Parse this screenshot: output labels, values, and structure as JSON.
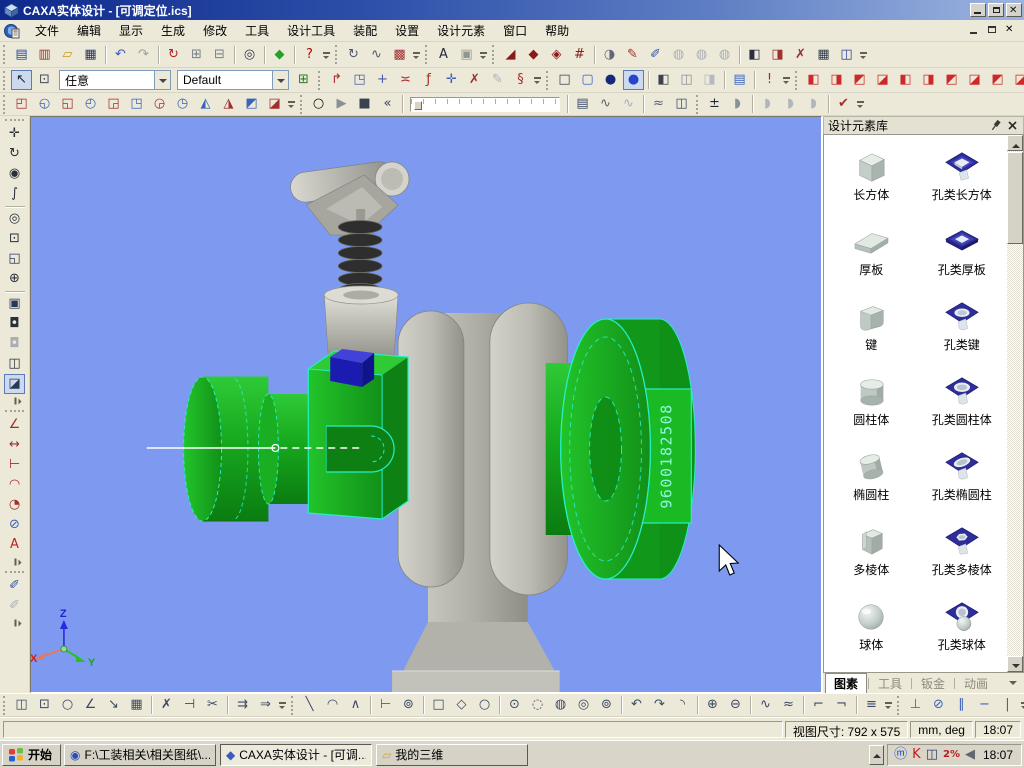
{
  "window": {
    "title": "CAXA实体设计 - [可调定位.ics]"
  },
  "menu": {
    "items": [
      "文件",
      "编辑",
      "显示",
      "生成",
      "修改",
      "工具",
      "设计工具",
      "装配",
      "设置",
      "设计元素",
      "窗口",
      "帮助"
    ]
  },
  "toolbars": {
    "row1": [
      {
        "t": "g"
      },
      {
        "n": "new-document",
        "g": "▤",
        "c": "#2a4a9a"
      },
      {
        "n": "new-from-template",
        "g": "▥",
        "c": "#a03030"
      },
      {
        "n": "open-file",
        "g": "▱",
        "c": "#c89a20"
      },
      {
        "n": "save-file",
        "g": "▦",
        "c": "#28306e"
      },
      {
        "t": "s"
      },
      {
        "n": "undo",
        "g": "↶",
        "c": "#3a5ac0"
      },
      {
        "n": "redo",
        "g": "↷",
        "c": "#9aa0a8"
      },
      {
        "t": "s"
      },
      {
        "n": "regenerate",
        "g": "↻",
        "c": "#a82828"
      },
      {
        "n": "copy-feature",
        "g": "⊞",
        "c": "#78808a"
      },
      {
        "n": "paste-feature",
        "g": "⊟",
        "c": "#78808a"
      },
      {
        "t": "s"
      },
      {
        "n": "search",
        "g": "◎",
        "c": "#303848"
      },
      {
        "t": "s"
      },
      {
        "n": "smart-render",
        "g": "◆",
        "c": "#28a028"
      },
      {
        "t": "s"
      },
      {
        "n": "context-help",
        "g": "?",
        "c": "#c00000"
      },
      {
        "t": "c"
      },
      {
        "t": "g"
      },
      {
        "n": "rotate-animation",
        "g": "↻",
        "c": "#505a78"
      },
      {
        "n": "path-animation",
        "g": "∿",
        "c": "#505a78"
      },
      {
        "n": "render-output",
        "g": "▩",
        "c": "#a03030"
      },
      {
        "t": "c"
      },
      {
        "t": "g"
      },
      {
        "n": "text-tool",
        "g": "A",
        "c": "#202838"
      },
      {
        "n": "image-tool",
        "g": "▣",
        "c": "#909890"
      },
      {
        "t": "c"
      },
      {
        "t": "g"
      },
      {
        "n": "extrude-feature",
        "g": "◢",
        "c": "#8a1a1a"
      },
      {
        "n": "revolve-feature",
        "g": "◆",
        "c": "#8a1a1a"
      },
      {
        "n": "sweep-feature",
        "g": "◈",
        "c": "#8a1a1a"
      },
      {
        "n": "loft-feature",
        "g": "#",
        "c": "#8a1a1a"
      },
      {
        "t": "s"
      },
      {
        "n": "stamp-feature",
        "g": "◑",
        "c": "#606878"
      },
      {
        "n": "edit-sketch",
        "g": "✎",
        "c": "#a03030"
      },
      {
        "n": "edit-feature",
        "g": "✐",
        "c": "#38589a"
      },
      {
        "n": "derive-gray-1",
        "g": "◍",
        "c": "#a8aeb4"
      },
      {
        "n": "derive-gray-2",
        "g": "◍",
        "c": "#a8aeb4"
      },
      {
        "n": "derive-gray-3",
        "g": "◍",
        "c": "#a8aeb4"
      },
      {
        "t": "s"
      },
      {
        "n": "boolean-subtract",
        "g": "◧",
        "c": "#283040"
      },
      {
        "n": "surface-tool",
        "g": "◨",
        "c": "#a03030"
      },
      {
        "n": "remove-face",
        "g": "✗",
        "c": "#903030"
      },
      {
        "n": "pattern-feature",
        "g": "▦",
        "c": "#303a48"
      },
      {
        "n": "mirror-feature",
        "g": "◫",
        "c": "#3040a0"
      },
      {
        "t": "c"
      }
    ],
    "row2": [
      {
        "t": "g"
      },
      {
        "n": "select-tool",
        "g": "↖",
        "c": "#202830",
        "p": true
      },
      {
        "n": "select-region",
        "g": "⊡",
        "c": "#404a58"
      },
      {
        "t": "d",
        "n": "selection-filter",
        "label": "任意",
        "w": 112
      },
      {
        "t": "d",
        "n": "style-preset",
        "label": "Default",
        "w": 112
      },
      {
        "n": "design-tree",
        "g": "⊞",
        "c": "#2a7a2a"
      },
      {
        "t": "g"
      },
      {
        "n": "generate-arrow",
        "g": "↱",
        "c": "#a82828"
      },
      {
        "n": "rotate-plane",
        "g": "◳",
        "c": "#4a5aa8"
      },
      {
        "n": "insert-plane",
        "g": "+",
        "c": "#4a5aa8"
      },
      {
        "n": "extrude-to-plane",
        "g": "≍",
        "c": "#a82828"
      },
      {
        "n": "equation-fx",
        "g": "ƒ",
        "c": "#a82828"
      },
      {
        "n": "smart-dimension",
        "g": "✛",
        "c": "#3a62b8"
      },
      {
        "n": "no-display",
        "g": "✗",
        "c": "#a03030"
      },
      {
        "n": "sketch-gray",
        "g": "✎",
        "c": "#aab0b6"
      },
      {
        "n": "spring-tool",
        "g": "§",
        "c": "#a03030"
      },
      {
        "t": "c"
      },
      {
        "t": "g"
      },
      {
        "n": "display-wireframe",
        "g": "□",
        "c": "#3a4250"
      },
      {
        "n": "display-hidden-line",
        "g": "▢",
        "c": "#3a62c8"
      },
      {
        "n": "display-shaded-dark",
        "g": "●",
        "c": "#142a7a"
      },
      {
        "n": "display-shaded",
        "g": "●",
        "c": "#2444cc",
        "p": true
      },
      {
        "t": "s"
      },
      {
        "n": "render-facet-1",
        "g": "◧",
        "c": "#3a4250"
      },
      {
        "n": "render-facet-2",
        "g": "◫",
        "c": "#8a9098"
      },
      {
        "n": "render-facet-3",
        "g": "◨",
        "c": "#b4bac0"
      },
      {
        "t": "s"
      },
      {
        "n": "property-table",
        "g": "▤",
        "c": "#3a62c8"
      },
      {
        "t": "s"
      },
      {
        "n": "interference-check",
        "g": "!",
        "c": "#a82828"
      },
      {
        "t": "c"
      },
      {
        "t": "g"
      },
      {
        "n": "view-front",
        "g": "◧",
        "c": "#cc2a2a"
      },
      {
        "n": "view-back",
        "g": "◨",
        "c": "#cc2a2a"
      },
      {
        "n": "view-left",
        "g": "◩",
        "c": "#cc2a2a"
      },
      {
        "n": "view-right",
        "g": "◪",
        "c": "#cc2a2a"
      },
      {
        "n": "view-top",
        "g": "◧",
        "c": "#cc2a2a"
      },
      {
        "n": "view-bottom",
        "g": "◨",
        "c": "#cc2a2a"
      },
      {
        "n": "view-iso-1",
        "g": "◩",
        "c": "#cc2a2a"
      },
      {
        "n": "view-iso-2",
        "g": "◪",
        "c": "#cc2a2a"
      },
      {
        "n": "view-iso-3",
        "g": "◩",
        "c": "#cc2a2a"
      },
      {
        "n": "view-iso-4",
        "g": "◪",
        "c": "#cc2a2a"
      },
      {
        "t": "c"
      }
    ],
    "row3": [
      {
        "t": "g"
      },
      {
        "n": "feature-helix",
        "g": "◰",
        "c": "#a03030"
      },
      {
        "n": "feature-shell",
        "g": "◵",
        "c": "#3a62b8"
      },
      {
        "n": "feature-draft",
        "g": "◱",
        "c": "#a03030"
      },
      {
        "n": "feature-rib",
        "g": "◴",
        "c": "#3a62b8"
      },
      {
        "n": "feature-hole",
        "g": "◲",
        "c": "#a03030"
      },
      {
        "n": "feature-thread",
        "g": "◳",
        "c": "#3a62b8"
      },
      {
        "n": "feature-fillet",
        "g": "◶",
        "c": "#a03030"
      },
      {
        "n": "feature-chamfer",
        "g": "◷",
        "c": "#3a62b8"
      },
      {
        "n": "feature-slice",
        "g": "◭",
        "c": "#3a62b8"
      },
      {
        "n": "feature-split",
        "g": "◮",
        "c": "#a03030"
      },
      {
        "n": "feature-wrap",
        "g": "◩",
        "c": "#3a62b8"
      },
      {
        "n": "feature-emboss",
        "g": "◪",
        "c": "#a03030"
      },
      {
        "t": "c"
      },
      {
        "t": "g"
      },
      {
        "n": "record-animation",
        "g": "○",
        "c": "#101010"
      },
      {
        "n": "play-animation",
        "g": "▶",
        "c": "#8a9098"
      },
      {
        "n": "stop-animation",
        "g": "■",
        "c": "#3a4250"
      },
      {
        "n": "rewind-animation",
        "g": "«",
        "c": "#3a4250"
      },
      {
        "t": "s"
      },
      {
        "t": "sl",
        "n": "animation-timeline"
      },
      {
        "t": "s"
      },
      {
        "n": "keyframe-film",
        "g": "▤",
        "c": "#3a4a6a"
      },
      {
        "n": "motion-curve",
        "g": "∿",
        "c": "#5a6270"
      },
      {
        "n": "motion-curve-gray",
        "g": "∿",
        "c": "#a8aeb4"
      },
      {
        "t": "s"
      },
      {
        "n": "edit-path",
        "g": "≈",
        "c": "#5a6270"
      },
      {
        "n": "film-settings",
        "g": "◫",
        "c": "#3a4a6a"
      },
      {
        "t": "g"
      },
      {
        "n": "tolerance-cube",
        "g": "±",
        "c": "#202830"
      },
      {
        "n": "half-section",
        "g": "◗",
        "c": "#8a9098"
      },
      {
        "t": "s"
      },
      {
        "n": "section-gray-1",
        "g": "◗",
        "c": "#b0b6bc"
      },
      {
        "n": "section-gray-2",
        "g": "◗",
        "c": "#b0b6bc"
      },
      {
        "n": "section-gray-3",
        "g": "◗",
        "c": "#b0b6bc"
      },
      {
        "t": "s"
      },
      {
        "n": "validate-check",
        "g": "✔",
        "c": "#a03030"
      },
      {
        "t": "c"
      }
    ],
    "left": [
      {
        "t": "g"
      },
      {
        "n": "pan-view",
        "g": "✛",
        "c": "#283038"
      },
      {
        "n": "orbit-view",
        "g": "↻",
        "c": "#283038"
      },
      {
        "n": "look-at",
        "g": "◉",
        "c": "#283038"
      },
      {
        "n": "walk-view",
        "g": "∫",
        "c": "#283038"
      },
      {
        "t": "s"
      },
      {
        "n": "zoom-view",
        "g": "◎",
        "c": "#283038"
      },
      {
        "n": "zoom-window",
        "g": "⊡",
        "c": "#283038"
      },
      {
        "n": "zoom-all",
        "g": "◱",
        "c": "#283858"
      },
      {
        "n": "set-rotate-center",
        "g": "⊕",
        "c": "#283038"
      },
      {
        "t": "s"
      },
      {
        "n": "display-monitor",
        "g": "▣",
        "c": "#283858"
      },
      {
        "n": "camera-view",
        "g": "◘",
        "c": "#283038"
      },
      {
        "n": "camera-gray",
        "g": "◘",
        "c": "#a8aeb4"
      },
      {
        "n": "camera-pair",
        "g": "◫",
        "c": "#283038"
      },
      {
        "n": "render-settings",
        "g": "◪",
        "c": "#283858",
        "p": true
      },
      {
        "t": "c"
      },
      {
        "t": "g"
      },
      {
        "n": "dimension-angle",
        "g": "∠",
        "c": "#a03030"
      },
      {
        "n": "dimension-linear",
        "g": "↔",
        "c": "#a03030"
      },
      {
        "n": "dimension-offset",
        "g": "⊢",
        "c": "#a03030"
      },
      {
        "n": "dimension-arc",
        "g": "◠",
        "c": "#a03030"
      },
      {
        "n": "dimension-radius",
        "g": "◔",
        "c": "#a03030"
      },
      {
        "n": "dimension-diameter",
        "g": "⊘",
        "c": "#3a62b8"
      },
      {
        "n": "annotation-text",
        "g": "A",
        "c": "#c02020"
      },
      {
        "t": "c"
      },
      {
        "t": "g"
      },
      {
        "n": "measure-tool",
        "g": "✐",
        "c": "#38589a"
      },
      {
        "n": "measure-tool-gray",
        "g": "✐",
        "c": "#aab0b6"
      },
      {
        "t": "c"
      }
    ],
    "bottom": [
      {
        "t": "g"
      },
      {
        "n": "sketch-two-views",
        "g": "◫",
        "c": "#3a4a66"
      },
      {
        "n": "sketch-zoom",
        "g": "⊡",
        "c": "#3a4a66"
      },
      {
        "n": "sketch-rotate",
        "g": "○",
        "c": "#3a4a66"
      },
      {
        "n": "sketch-angle-snap",
        "g": "∠",
        "c": "#3a4a66"
      },
      {
        "n": "sketch-move-origin",
        "g": "↘",
        "c": "#3a4a66"
      },
      {
        "n": "sketch-grid",
        "g": "▦",
        "c": "#3a4a66"
      },
      {
        "t": "s"
      },
      {
        "n": "sketch-delete",
        "g": "✗",
        "c": "#3a4a66"
      },
      {
        "n": "sketch-trim",
        "g": "⊣",
        "c": "#3a4a66"
      },
      {
        "n": "sketch-delete-multi",
        "g": "✂",
        "c": "#3a4a66"
      },
      {
        "t": "s"
      },
      {
        "n": "sketch-offset",
        "g": "⇉",
        "c": "#3a4a66"
      },
      {
        "n": "sketch-offset-multi",
        "g": "⇒",
        "c": "#3a4a66"
      },
      {
        "t": "c"
      },
      {
        "t": "g"
      },
      {
        "n": "draw-line",
        "g": "╲",
        "c": "#3a4a66"
      },
      {
        "n": "draw-tangent-arc",
        "g": "◠",
        "c": "#3a4a66"
      },
      {
        "n": "draw-angle-lines",
        "g": "∧",
        "c": "#3a4a66"
      },
      {
        "t": "s"
      },
      {
        "n": "construction-line",
        "g": "⊢",
        "c": "#3a62b8"
      },
      {
        "n": "reference-point",
        "g": "⊚",
        "c": "#3a4a66"
      },
      {
        "t": "s"
      },
      {
        "n": "draw-rectangle",
        "g": "□",
        "c": "#3a4a66"
      },
      {
        "n": "draw-diamond",
        "g": "◇",
        "c": "#3a4a66"
      },
      {
        "n": "draw-polygon",
        "g": "○",
        "c": "#3a4a66"
      },
      {
        "t": "s"
      },
      {
        "n": "circle-center",
        "g": "⊙",
        "c": "#3a4a66"
      },
      {
        "n": "circle-2pt",
        "g": "◌",
        "c": "#3a4a66"
      },
      {
        "n": "circle-3pt",
        "g": "◍",
        "c": "#3a4a66"
      },
      {
        "n": "circle-tangent",
        "g": "◎",
        "c": "#3a4a66"
      },
      {
        "n": "circle-radius",
        "g": "⊚",
        "c": "#3a4a66"
      },
      {
        "t": "s"
      },
      {
        "n": "arc-start-end",
        "g": "↶",
        "c": "#3a4a66"
      },
      {
        "n": "arc-center",
        "g": "↷",
        "c": "#3a4a66"
      },
      {
        "n": "arc-3pt",
        "g": "◝",
        "c": "#3a4a66"
      },
      {
        "t": "s"
      },
      {
        "n": "ellipse-center",
        "g": "⊕",
        "c": "#3a4a66"
      },
      {
        "n": "ellipse-axis",
        "g": "⊖",
        "c": "#3a4a66"
      },
      {
        "t": "s"
      },
      {
        "n": "spline",
        "g": "∿",
        "c": "#3a4a66"
      },
      {
        "n": "spline-edit",
        "g": "≈",
        "c": "#3a4a66"
      },
      {
        "t": "s"
      },
      {
        "n": "chamfer-2d",
        "g": "⌐",
        "c": "#3a4a66"
      },
      {
        "n": "fillet-2d",
        "g": "¬",
        "c": "#3a4a66"
      },
      {
        "t": "s"
      },
      {
        "n": "sketch-pattern",
        "g": "≡",
        "c": "#3a4a66"
      },
      {
        "t": "c"
      },
      {
        "t": "g"
      },
      {
        "n": "constraint-perpendicular",
        "g": "⊥",
        "c": "#3a62b8"
      },
      {
        "n": "constraint-tangent",
        "g": "⊘",
        "c": "#3a62b8"
      },
      {
        "n": "constraint-parallel",
        "g": "∥",
        "c": "#3a62b8"
      },
      {
        "n": "constraint-horizontal",
        "g": "−",
        "c": "#3a62b8"
      },
      {
        "n": "constraint-vertical",
        "g": "|",
        "c": "#3a62b8"
      },
      {
        "t": "c"
      }
    ]
  },
  "viewport": {
    "part_number": "9600182508",
    "axis": {
      "x": "X",
      "y": "Y",
      "z": "Z"
    }
  },
  "library": {
    "title": "设计元素库",
    "items": [
      {
        "label": "长方体",
        "icon": "cube"
      },
      {
        "label": "孔类长方体",
        "icon": "hole-cube"
      },
      {
        "label": "厚板",
        "icon": "plate"
      },
      {
        "label": "孔类厚板",
        "icon": "hole-plate"
      },
      {
        "label": "键",
        "icon": "key"
      },
      {
        "label": "孔类键",
        "icon": "hole-key"
      },
      {
        "label": "圆柱体",
        "icon": "cylinder"
      },
      {
        "label": "孔类圆柱体",
        "icon": "hole-cylinder"
      },
      {
        "label": "椭圆柱",
        "icon": "ellcyl"
      },
      {
        "label": "孔类椭圆柱",
        "icon": "hole-ellcyl"
      },
      {
        "label": "多棱体",
        "icon": "prism"
      },
      {
        "label": "孔类多棱体",
        "icon": "hole-prism"
      },
      {
        "label": "球体",
        "icon": "sphere"
      },
      {
        "label": "孔类球体",
        "icon": "hole-sphere"
      }
    ],
    "tabs": [
      {
        "label": "图素",
        "active": true
      },
      {
        "label": "工具",
        "active": false
      },
      {
        "label": "钣金",
        "active": false
      },
      {
        "label": "动画",
        "active": false
      }
    ]
  },
  "statusbar": {
    "message": "",
    "view_size": "视图尺寸: 792 x 575",
    "units": "mm, deg",
    "time": "18:07"
  },
  "taskbar": {
    "start_label": "开始",
    "tasks": [
      {
        "n": "task-acdsee",
        "g": "◉",
        "c": "#2a50b8",
        "label": "F:\\工装相关\\相关图纸\\...",
        "active": false
      },
      {
        "n": "task-caxa",
        "g": "◆",
        "c": "#3a5ac0",
        "label": "CAXA实体设计 - [可调...",
        "active": true
      },
      {
        "n": "task-folder",
        "g": "▱",
        "c": "#d8a828",
        "label": "我的三维",
        "active": false
      }
    ],
    "tray": {
      "icons": [
        {
          "n": "tray-browser",
          "g": "ⓜ",
          "c": "#1a52c8"
        },
        {
          "n": "tray-antivirus",
          "g": "K",
          "c": "#cc1818"
        },
        {
          "n": "tray-network",
          "g": "◫",
          "c": "#30426a"
        },
        {
          "n": "tray-cpu",
          "g": "2%",
          "c": "#b02020",
          "small": true
        },
        {
          "n": "tray-volume",
          "g": "◀",
          "c": "#606870"
        }
      ],
      "clock": "18:07"
    }
  }
}
